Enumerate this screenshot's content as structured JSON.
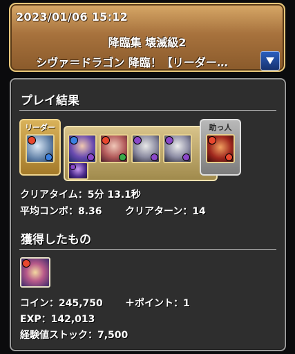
{
  "header": {
    "datetime": "2023/01/06 15:12",
    "quest_title": "降臨集 壊滅級2",
    "quest_subtitle": "シヴァ＝ドラゴン 降臨！【リーダー…"
  },
  "result": {
    "section_title": "プレイ結果",
    "leader_label": "リーダー",
    "helper_label": "助っ人",
    "clear_time_label": "クリアタイム：",
    "clear_time_value": "5分 13.1秒",
    "avg_combo_label": "平均コンボ：",
    "avg_combo_value": "8.36",
    "clear_turn_label": "クリアターン：",
    "clear_turn_value": "14"
  },
  "rewards": {
    "section_title": "獲得したもの",
    "coin_label": "コイン：",
    "coin_value": "245,750",
    "points_label": "＋ポイント：",
    "points_value": "1",
    "exp_label": "EXP：",
    "exp_value": "142,013",
    "exp_stock_label": "経験値ストック：",
    "exp_stock_value": "7,500"
  },
  "icons": {
    "dropdown": "dropdown-arrow-icon"
  },
  "colors": {
    "fire": "#e8472e",
    "water": "#3a7fe0",
    "dark": "#8a48c8",
    "wood": "#3aa84a"
  }
}
